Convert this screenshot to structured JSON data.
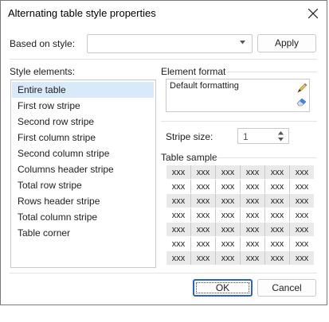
{
  "dialog": {
    "title": "Alternating table style properties"
  },
  "based_on": {
    "label": "Based on style:",
    "value": "",
    "apply_label": "Apply"
  },
  "style_elements": {
    "label": "Style elements:",
    "selected_index": 0,
    "items": [
      "Entire table",
      "First row stripe",
      "Second row stripe",
      "First column stripe",
      "Second column stripe",
      "Columns header stripe",
      "Total row stripe",
      "Rows header stripe",
      "Total column stripe",
      "Table corner"
    ]
  },
  "element_format": {
    "label": "Element format",
    "text": "Default formatting"
  },
  "stripe_size": {
    "label": "Stripe size:",
    "value": "1"
  },
  "table_sample": {
    "label": "Table sample",
    "cell_text": "xxx",
    "rows": 7,
    "cols": 6
  },
  "footer": {
    "ok_label": "OK",
    "cancel_label": "Cancel"
  },
  "colors": {
    "selection": "#d8eaf9",
    "focus_border": "#2b64c8",
    "stripe": "#e9e9e9"
  }
}
